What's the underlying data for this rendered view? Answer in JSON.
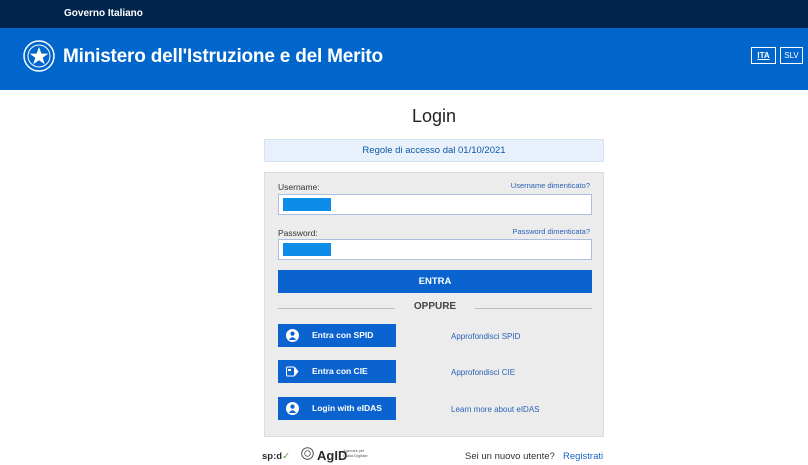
{
  "gov_bar": {
    "label": "Governo Italiano"
  },
  "header": {
    "title": "Ministero dell'Istruzione e del Merito",
    "lang_ita": "ITA",
    "lang_slv": "SLV"
  },
  "page": {
    "title": "Login"
  },
  "rules": {
    "text": "Regole di accesso dal 01/10/2021"
  },
  "form": {
    "username_label": "Username:",
    "username_forgot": "Username dimenticato?",
    "password_label": "Password:",
    "password_forgot": "Password dimenticata?",
    "submit": "ENTRA",
    "separator": "OPPURE"
  },
  "auth_options": [
    {
      "button": "Entra con SPID",
      "link": "Approfondisci SPID",
      "icon": "user-icon"
    },
    {
      "button": "Entra con CIE",
      "link": "Approfondisci CIE",
      "icon": "cie-card-icon"
    },
    {
      "button": "Login with eIDAS",
      "link": "Learn more about eIDAS",
      "icon": "user-icon"
    }
  ],
  "footer": {
    "spid_logo": "sp:d",
    "spid_check": "✓",
    "agid_logo": "AgID",
    "agid_sub": "Agenzia per l'Italia Digitale",
    "new_user_text": "Sei un nuovo utente?",
    "register_link": "Registrati"
  },
  "colors": {
    "gov_bar": "#01254c",
    "header": "#0066cc",
    "primary_button": "#0a63cf",
    "link": "#2a62b8"
  }
}
